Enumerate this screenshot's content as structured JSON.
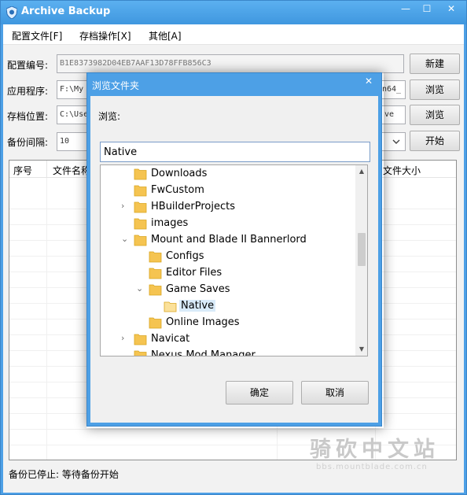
{
  "window": {
    "title": "Archive Backup",
    "min_glyph": "—",
    "max_glyph": "☐",
    "close_glyph": "✕"
  },
  "menu": [
    {
      "label": "配置文件[F]"
    },
    {
      "label": "存档操作[X]"
    },
    {
      "label": "其他[A]"
    }
  ],
  "form": {
    "config_label": "配置编号:",
    "config_value": "B1E8373982D04EB7AAF13D78FFB856C3",
    "new_button": "新建",
    "app_label": "应用程序:",
    "app_value_left": "F:\\My",
    "app_value_right": "n64_",
    "browse_button_1": "浏览",
    "save_label": "存档位置:",
    "save_value_left": "C:\\Use",
    "save_value_right": "ve",
    "browse_button_2": "浏览",
    "interval_label": "备份间隔:",
    "interval_value": "10",
    "start_button": "开始"
  },
  "list": {
    "columns": [
      "序号",
      "文件名称",
      "文件大小"
    ]
  },
  "status": "备份已停止:  等待备份开始",
  "watermark": {
    "main": "骑砍中文站",
    "sub": "bbs.mountblade.com.cn"
  },
  "dialog": {
    "title": "浏览文件夹",
    "close_glyph": "✕",
    "browse_label": "浏览:",
    "path_value": "Native",
    "tree": [
      {
        "label": "Downloads",
        "expander": ""
      },
      {
        "label": "FwCustom",
        "expander": ""
      },
      {
        "label": "HBuilderProjects",
        "expander": "›"
      },
      {
        "label": "images",
        "expander": ""
      },
      {
        "label": "Mount and Blade II Bannerlord",
        "expander": "⌄"
      },
      {
        "label": "Configs",
        "expander": ""
      },
      {
        "label": "Editor Files",
        "expander": ""
      },
      {
        "label": "Game Saves",
        "expander": "⌄"
      },
      {
        "label": "Native",
        "expander": "",
        "selected": true
      },
      {
        "label": "Online Images",
        "expander": ""
      },
      {
        "label": "Navicat",
        "expander": "›"
      },
      {
        "label": "Nexus Mod Manager",
        "expander": ""
      }
    ],
    "ok_button": "确定",
    "cancel_button": "取消"
  },
  "colors": {
    "title_bar": "#4da0e6",
    "folder": "#f5c451",
    "selection": "#d9ebf9"
  }
}
